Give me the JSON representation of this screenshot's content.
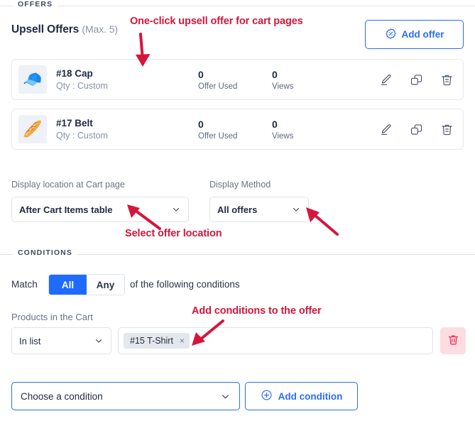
{
  "sections": {
    "offers_legend": "OFFERS",
    "conditions_legend": "CONDITIONS"
  },
  "offers": {
    "heading": "Upsell Offers",
    "heading_max": "(Max. 5)",
    "add_button": "Add offer",
    "add_button_icon": "percent-badge-icon",
    "rows": [
      {
        "thumb": "🧢",
        "title": "#18 Cap",
        "subtitle": "Qty : Custom",
        "used_value": "0",
        "used_label": "Offer Used",
        "views_value": "0",
        "views_label": "Views"
      },
      {
        "thumb": "🥖",
        "title": "#17 Belt",
        "subtitle": "Qty : Custom",
        "used_value": "0",
        "used_label": "Offer Used",
        "views_value": "0",
        "views_label": "Views"
      }
    ],
    "row_actions": [
      "edit-icon",
      "duplicate-icon",
      "delete-icon"
    ]
  },
  "display": {
    "location_label": "Display location at Cart page",
    "location_value": "After Cart Items table",
    "method_label": "Display Method",
    "method_value": "All offers"
  },
  "conditions": {
    "match_prefix": "Match",
    "match_all": "All",
    "match_any": "Any",
    "match_suffix": "of the following conditions",
    "active_match": "All",
    "field_label": "Products in the Cart",
    "operator_value": "In list",
    "tags": [
      {
        "label": "#15 T-Shirt",
        "remove": "×"
      }
    ],
    "delete_row_icon": "trash-icon",
    "choose_placeholder": "Choose a condition",
    "add_condition_label": "Add condition",
    "add_condition_icon": "plus-circle-icon"
  },
  "annotations": [
    {
      "text": "One-click upsell offer for cart pages"
    },
    {
      "text": "Select offer location"
    },
    {
      "text": "Add conditions to the offer"
    }
  ],
  "colors": {
    "accent_blue": "#2b6cf5",
    "segment_active": "#1f6bff",
    "annotation_red": "#d4163c",
    "danger_bg": "#fcdde2",
    "danger_fg": "#f0304f"
  }
}
